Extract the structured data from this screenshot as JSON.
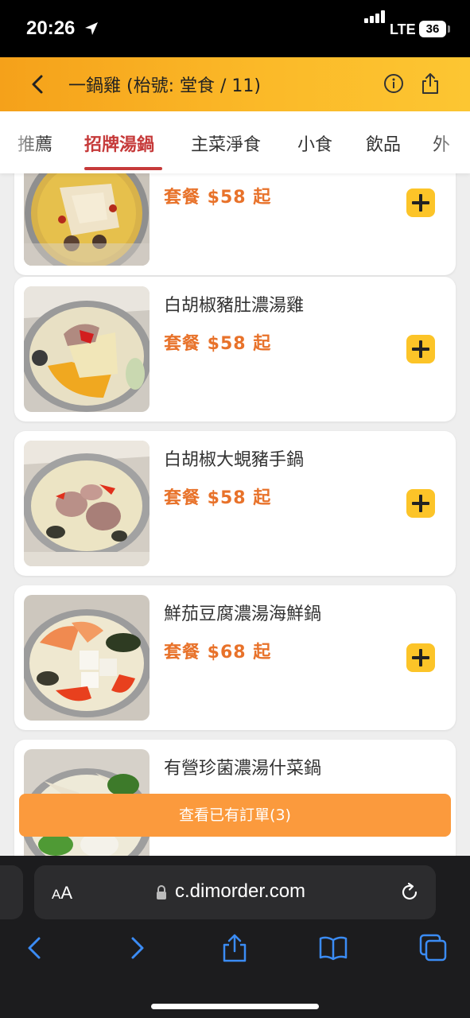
{
  "status_bar": {
    "time": "20:26",
    "network": "LTE",
    "battery": "36"
  },
  "header": {
    "title": "一鍋雞 (枱號: 堂食 / 11)",
    "back_icon": "chevron-left-icon",
    "info_icon": "info-icon",
    "share_icon": "share-icon"
  },
  "tabs": [
    {
      "label": "推薦"
    },
    {
      "label": "招牌湯鍋",
      "active": true
    },
    {
      "label": "主菜淨食"
    },
    {
      "label": "小食"
    },
    {
      "label": "飲品"
    },
    {
      "label": "外"
    }
  ],
  "menu": {
    "items": [
      {
        "name": "",
        "price": "套餐 $58 起"
      },
      {
        "name": "白胡椒豬肚濃湯雞",
        "price": "套餐 $58 起"
      },
      {
        "name": "白胡椒大蜆豬手鍋",
        "price": "套餐 $58 起"
      },
      {
        "name": "鮮茄豆腐濃湯海鮮鍋",
        "price": "套餐 $68 起"
      },
      {
        "name": "有營珍菌濃湯什菜鍋",
        "price": ""
      }
    ]
  },
  "order_button": {
    "label": "查看已有訂單(3)"
  },
  "safari": {
    "aa_small": "A",
    "aa_large": "A",
    "url": "c.dimorder.com",
    "icons": [
      "back-icon",
      "forward-icon",
      "share-icon",
      "bookmarks-icon",
      "tabs-icon"
    ]
  },
  "colors": {
    "header_orange": "#fbb928",
    "active_tab": "#c63a3a",
    "price": "#e8722a",
    "add_button": "#fcc428",
    "order_button": "#fb9a3d"
  }
}
